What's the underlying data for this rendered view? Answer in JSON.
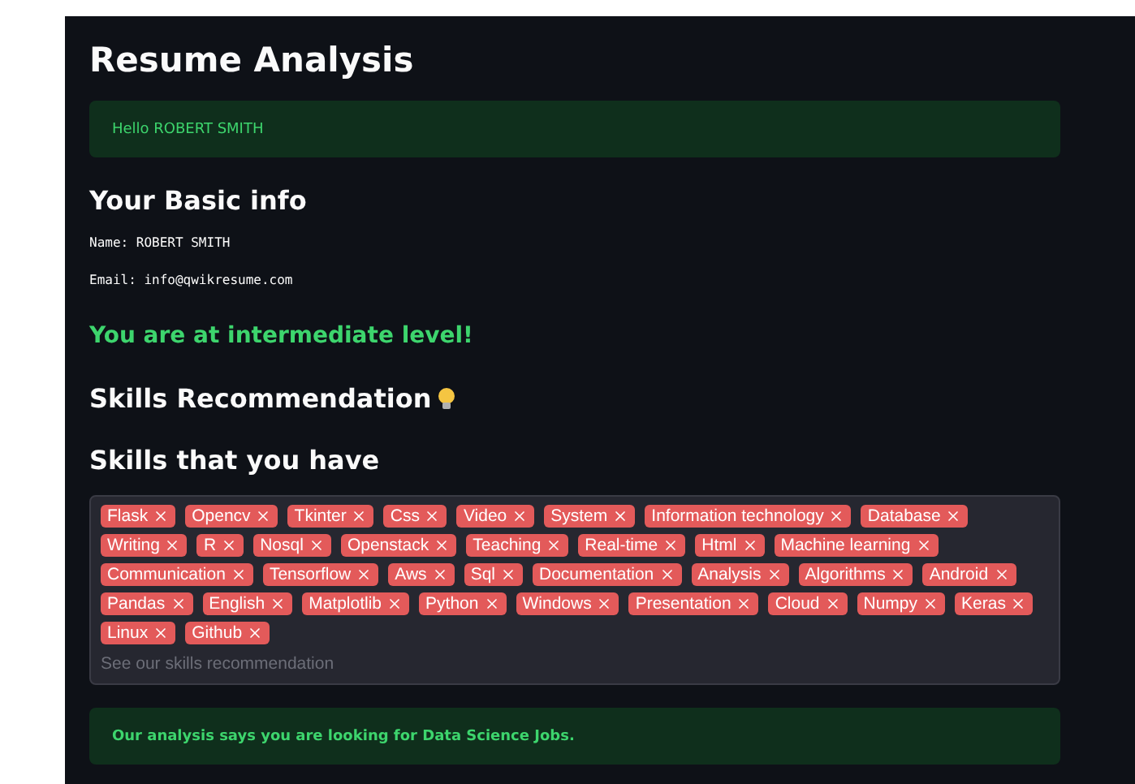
{
  "title": "Resume Analysis",
  "greeting": {
    "text": "Hello ROBERT SMITH",
    "kind": "success"
  },
  "basic_info": {
    "heading": "Your Basic info",
    "lines": [
      "Name: ROBERT SMITH",
      "Email: info@qwikresume.com"
    ]
  },
  "level_message": "You are at intermediate level!",
  "recommendation_heading": "Skills Recommendation",
  "skills": {
    "heading": "Skills that you have",
    "tags": [
      "Flask",
      "Opencv",
      "Tkinter",
      "Css",
      "Video",
      "System",
      "Information technology",
      "Database",
      "Writing",
      "R",
      "Nosql",
      "Openstack",
      "Teaching",
      "Real-time",
      "Html",
      "Machine learning",
      "Communication",
      "Tensorflow",
      "Aws",
      "Sql",
      "Documentation",
      "Analysis",
      "Algorithms",
      "Android",
      "Pandas",
      "English",
      "Matplotlib",
      "Python",
      "Windows",
      "Presentation",
      "Cloud",
      "Numpy",
      "Keras",
      "Linux",
      "Github"
    ],
    "placeholder": "See our skills recommendation"
  },
  "result": {
    "text": "Our analysis says you are looking for Data Science Jobs.",
    "kind": "success"
  }
}
